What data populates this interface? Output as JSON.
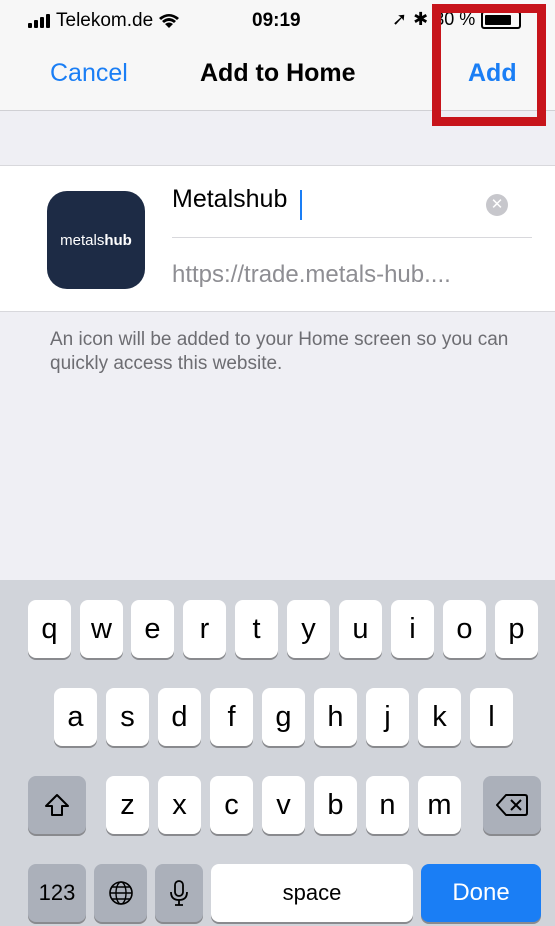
{
  "status_bar": {
    "carrier": "Telekom.de",
    "time": "09:19",
    "battery_text": "30 %"
  },
  "nav": {
    "cancel": "Cancel",
    "title": "Add to Home",
    "add": "Add"
  },
  "form": {
    "icon_text_regular": "metals",
    "icon_text_bold": "hub",
    "name_value": "Metalshub",
    "url": "https://trade.metals-hub...."
  },
  "hint": "An icon will be added to your Home screen so you can quickly access this website.",
  "keyboard": {
    "row1": [
      "q",
      "w",
      "e",
      "r",
      "t",
      "y",
      "u",
      "i",
      "o",
      "p"
    ],
    "row2": [
      "a",
      "s",
      "d",
      "f",
      "g",
      "h",
      "j",
      "k",
      "l"
    ],
    "row3": [
      "z",
      "x",
      "c",
      "v",
      "b",
      "n",
      "m"
    ],
    "numbers": "123",
    "space": "space",
    "done": "Done"
  },
  "colors": {
    "accent": "#1a7ef5",
    "highlight": "#c7141b",
    "icon_bg": "#1d2b45"
  }
}
